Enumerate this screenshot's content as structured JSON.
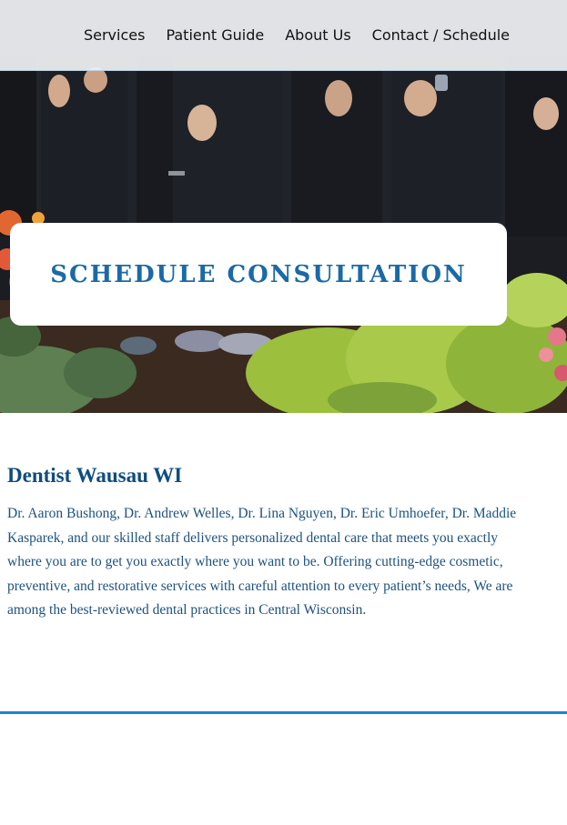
{
  "nav": {
    "items": [
      {
        "label": "Services"
      },
      {
        "label": "Patient Guide"
      },
      {
        "label": "About Us"
      },
      {
        "label": "Contact / Schedule"
      }
    ]
  },
  "hero": {
    "cta_label": "SCHEDULE CONSULTATION"
  },
  "main": {
    "heading": "Dentist Wausau WI",
    "intro": "Dr. Aaron Bushong, Dr. Andrew Welles, Dr. Lina Nguyen, Dr. Eric Umhoefer, Dr. Maddie Kasparek, and our skilled staff delivers personalized dental care that meets you exactly where you are to get you exactly where you want to be. Offering cutting-edge cosmetic, preventive, and restorative services with careful attention to every patient’s needs, We are among the best-reviewed dental practices in Central Wisconsin."
  },
  "colors": {
    "brand_blue": "#1a6aa6",
    "heading_blue": "#0e4d80",
    "divider_blue": "#1688d0"
  }
}
